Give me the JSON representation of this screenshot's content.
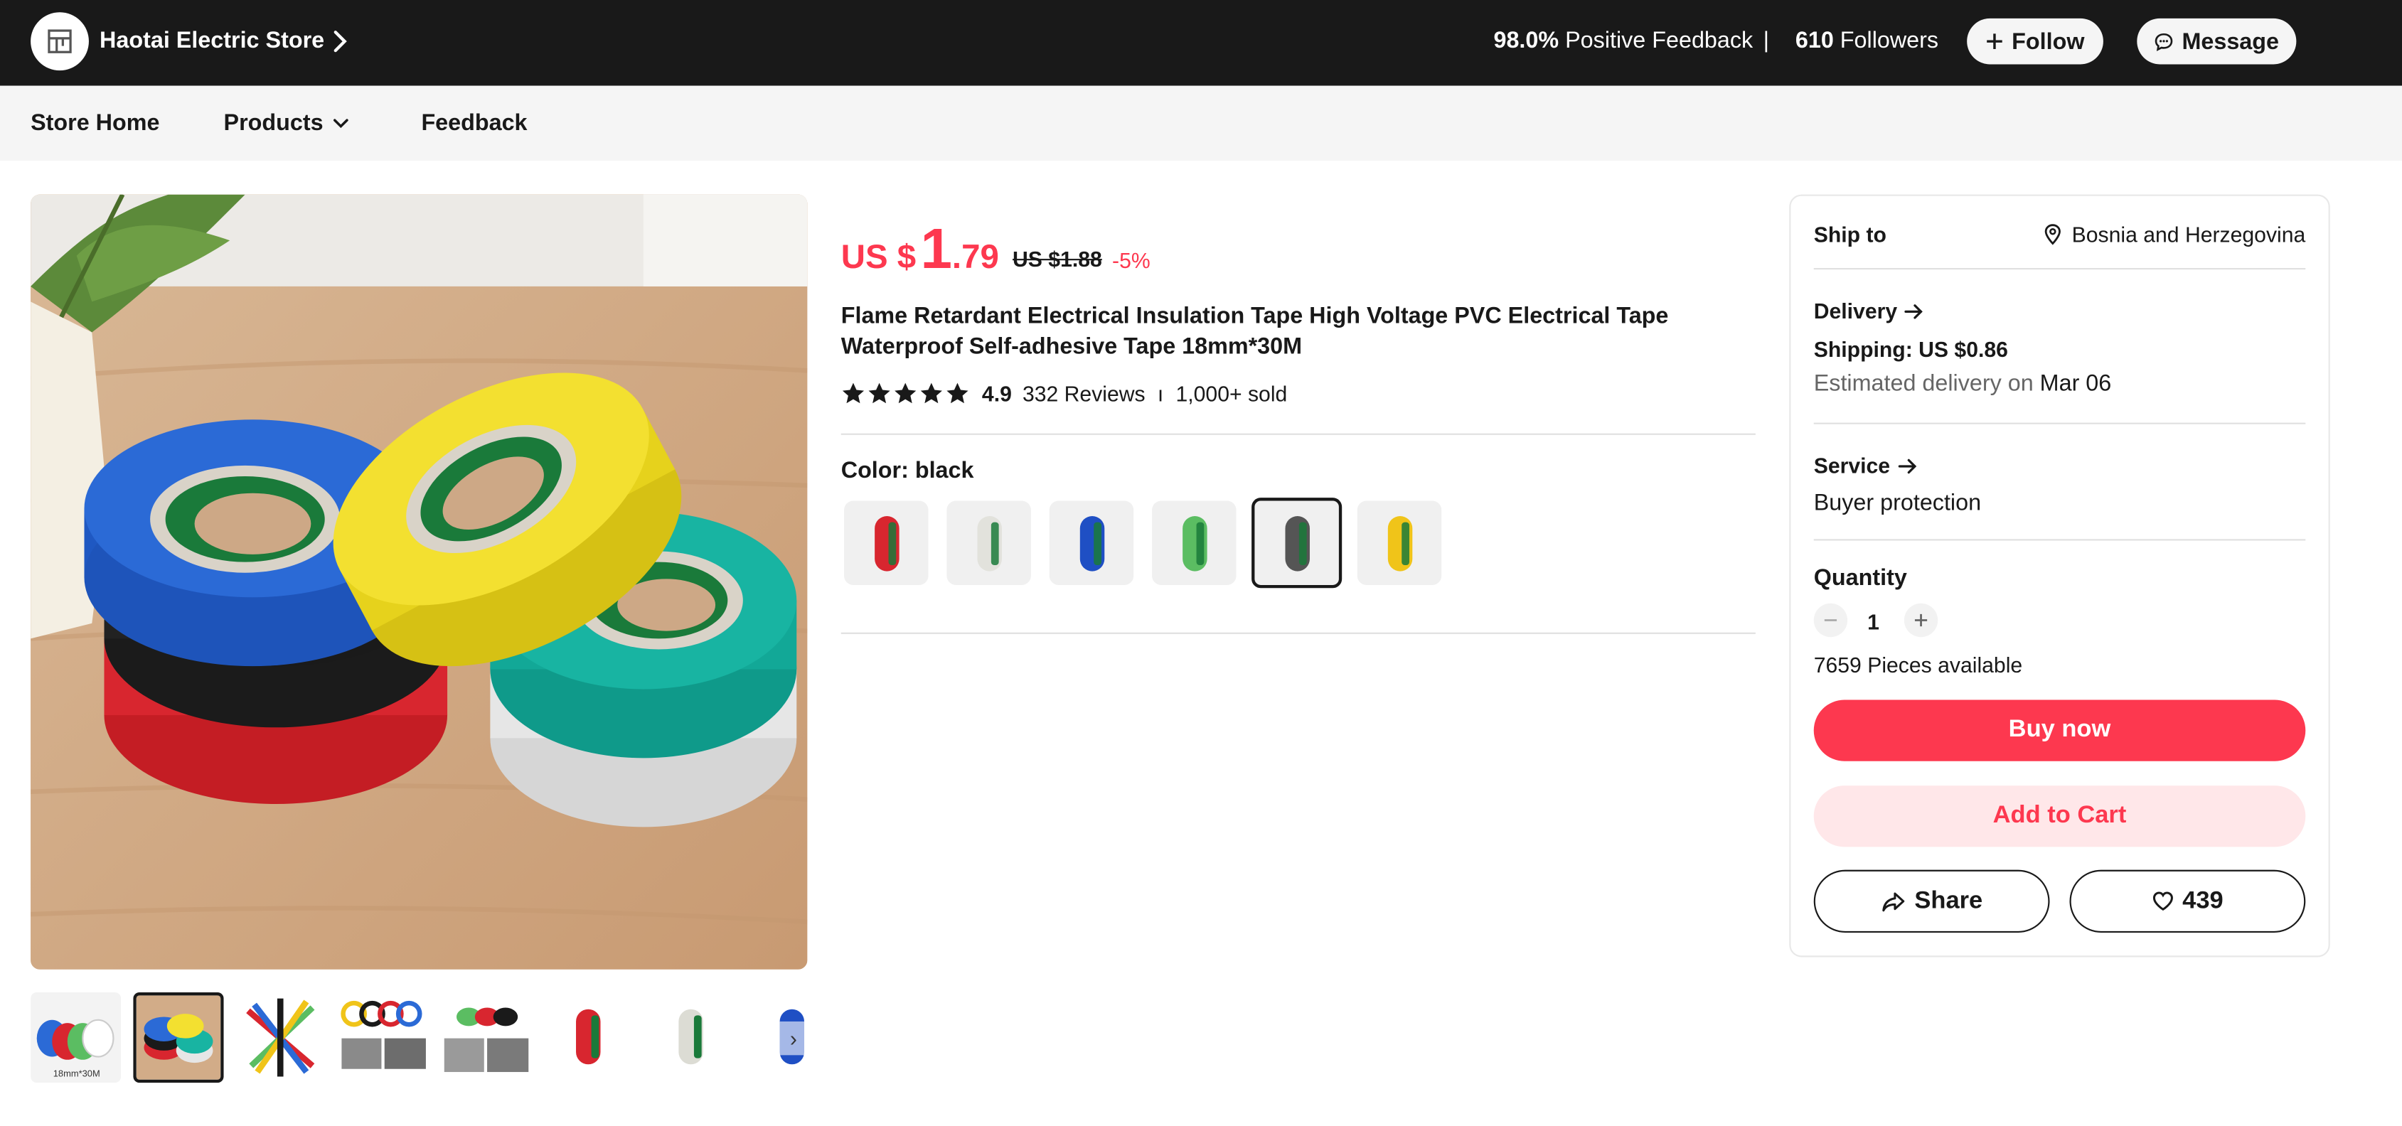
{
  "store": {
    "name": "Haotai Electric Store",
    "feedback_pct": "98.0%",
    "feedback_label": "Positive Feedback",
    "separator": "|",
    "followers_count": "610",
    "followers_label": "Followers",
    "follow_label": "Follow",
    "message_label": "Message"
  },
  "nav": {
    "home": "Store Home",
    "products": "Products",
    "feedback": "Feedback"
  },
  "product": {
    "currency": "US $",
    "price_int": "1",
    "price_dec": ".79",
    "old_price": "US $1.88",
    "discount": "-5%",
    "title": "Flame Retardant Electrical Insulation Tape High Voltage PVC Electrical Tape Waterproof Self-adhesive Tape 18mm*30M",
    "rating": "4.9",
    "stars": 5,
    "reviews": "332 Reviews",
    "rating_sep": "ı",
    "sold": "1,000+ sold",
    "color_label": "Color: black",
    "swatch_colors": [
      "#d8262f",
      "#e2e2dc",
      "#1f4fc4",
      "#5bbd62",
      "#555555",
      "#f0c419"
    ],
    "selected_color": "black",
    "thumbnail_caption": "18mm*30M"
  },
  "panel": {
    "ship_to_label": "Ship to",
    "ship_to_value": "Bosnia and Herzegovina",
    "delivery_label": "Delivery",
    "shipping": "Shipping: US $0.86",
    "estimated_prefix": "Estimated delivery on",
    "estimated_date": "Mar 06",
    "service_label": "Service",
    "service_value": "Buyer protection",
    "quantity_label": "Quantity",
    "quantity": "1",
    "available": "7659 Pieces available",
    "buy_now": "Buy now",
    "add_to_cart": "Add to Cart",
    "share": "Share",
    "wishlist_count": "439"
  }
}
